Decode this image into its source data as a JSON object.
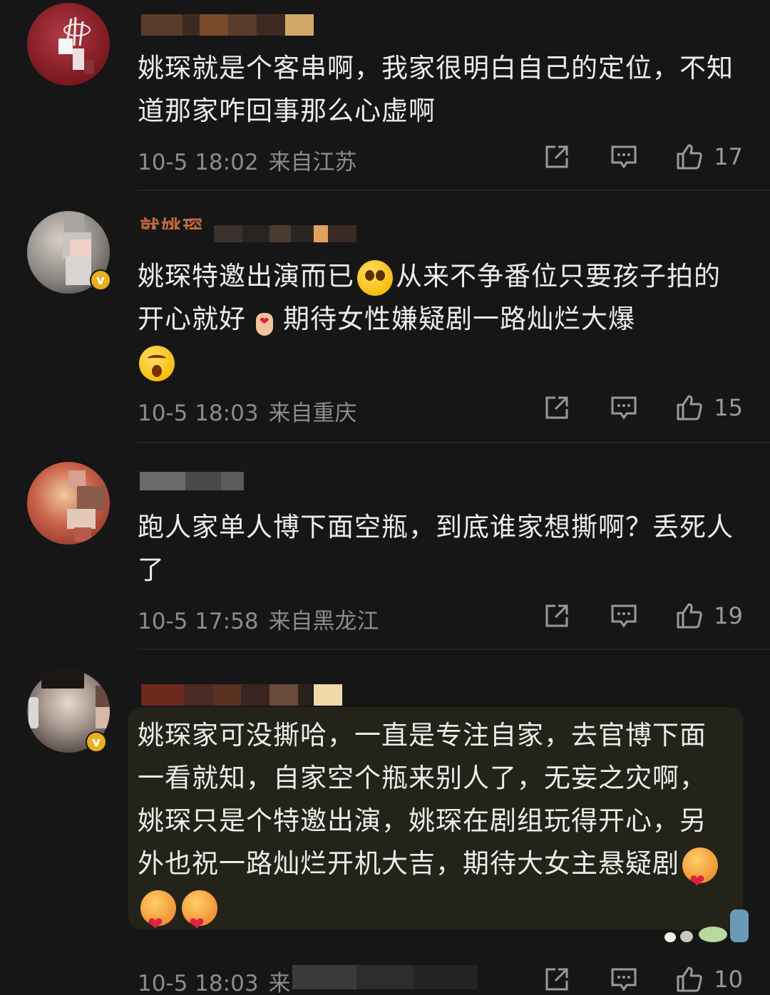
{
  "comments": [
    {
      "text": "姚琛就是个客串啊，我家很明白自己的定位，不知道那家咋回事那么心虚啊",
      "time": "10-5 18:02",
      "location": "来自江苏",
      "likes": "17"
    },
    {
      "name_partial": "就姚琛",
      "text_a": "姚琛特邀出演而已",
      "text_b": "从来不争番位只要孩子拍的开心就好",
      "text_c": "期待女性嫌疑剧一路灿烂大爆",
      "emoji_1": "pleading-face",
      "emoji_2": "finger-heart",
      "emoji_3": "shocked-face",
      "time": "10-5 18:03",
      "location": "来自重庆",
      "likes": "15"
    },
    {
      "text": "跑人家单人博下面空瓶，到底谁家想撕啊？丢死人了",
      "time": "10-5 17:58",
      "location": "来自黑龙江",
      "likes": "19"
    },
    {
      "text": "姚琛家可没撕哈，一直是专注自家，去官博下面一看就知，自家空个瓶来别人了，无妄之灾啊，姚琛只是个特邀出演，姚琛在剧组玩得开心，另外也祝一路灿烂开机大吉，期待大女主悬疑剧",
      "emoji": "love-face",
      "time": "10-5 18:03",
      "location_partial": "来",
      "likes": "10"
    }
  ],
  "colors": {
    "background": "#161616",
    "text": "#ececec",
    "meta": "#8c8c8c",
    "verified": "#e8b020",
    "highlight": "#232319"
  }
}
